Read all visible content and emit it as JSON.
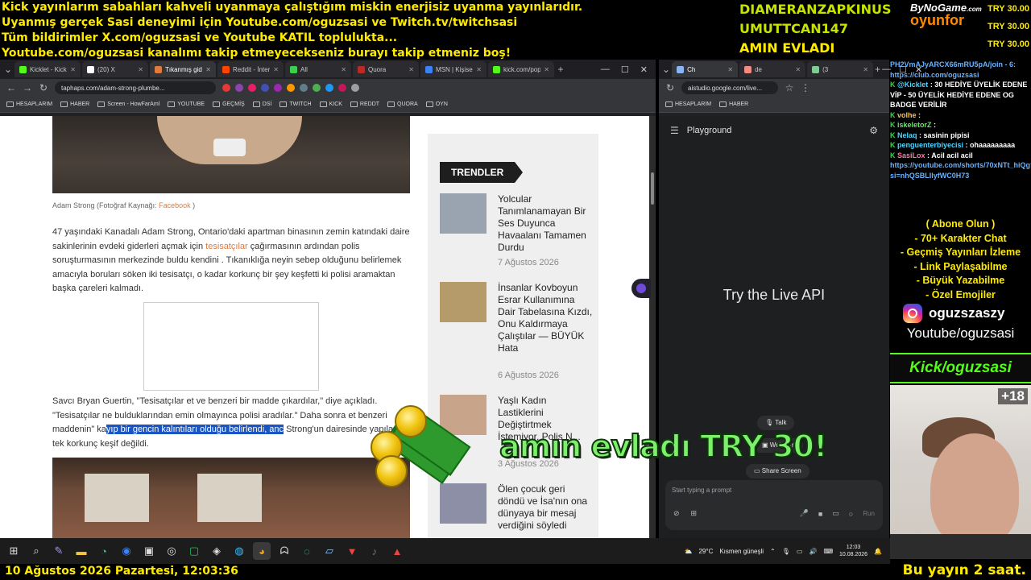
{
  "ticker": [
    "Kick yayınlarım sabahları kahveli uyanmaya çalıştığım miskin enerjisiz uyanma yayınlarıdır.",
    "Uyanmış gerçek Sasi deneyimi için Youtube.com/oguzsasi ve Twitch.tv/twitchsasi",
    "Tüm bildirimler X.com/oguzsasi ve Youtube KATIL toplulukta...",
    "Youtube.com/oguzsasi kanalımı takip etmeyecekseniz burayı takip etmeniz boş!"
  ],
  "donors": [
    "DIAMERANZAPKINUS",
    "UMUTTCAN147",
    "AMIN EVLADI"
  ],
  "brand": {
    "line1": "ByNoGame",
    "line2": "oyunfor",
    "dotcom": ".com"
  },
  "try_amounts": [
    "TRY 30.00",
    "TRY 30.00",
    "TRY 30.00"
  ],
  "browser_left": {
    "tabs": [
      {
        "label": "Kicklet - Kick",
        "color": "#53fc18"
      },
      {
        "label": "(20) X",
        "color": "#ffffff"
      },
      {
        "label": "Tıkanmış gide",
        "color": "#e07a3d"
      },
      {
        "label": "Reddit - İnter",
        "color": "#ff4500"
      },
      {
        "label": "All",
        "color": "#3cd04f"
      },
      {
        "label": "Quora",
        "color": "#b92b27"
      },
      {
        "label": "MSN | Kişisel",
        "color": "#3b82f6"
      },
      {
        "label": "kick.com/pop",
        "color": "#53fc18"
      }
    ],
    "url": "taphaps.com/adam-strong-plumbe...",
    "bookmarks": [
      "HESAPLARIM",
      "HABER",
      "Screen - HowFarAml",
      "YOUTUBE",
      "GEÇMİŞ",
      "DSİ",
      "TWITCH",
      "KICK",
      "REDDT",
      "QUORA",
      "OYN"
    ]
  },
  "article": {
    "caption_prefix": "Adam Strong (Fotoğraf Kaynağı: ",
    "caption_source": "Facebook",
    "caption_suffix": " )",
    "para1_a": "47 yaşındaki Kanadalı Adam Strong, Ontario'daki apartman binasının zemin katındaki daire sakinlerinin evdeki giderleri açmak için ",
    "para1_link": "tesisatçılar",
    "para1_b": " çağırmasının ardından polis soruşturmasının merkezinde buldu kendini . Tıkanıklığa neyin sebep olduğunu belirlemek amacıyla boruları söken iki tesisatçı, o kadar korkunç bir şey keşfetti ki polisi aramaktan başka çareleri kalmadı.",
    "para2_a": "Savcı Bryan Guertin, \"Tesisatçılar et ve benzeri bir madde çıkardılar,\" diye açıkladı. \"Tesisatçılar ne bulduklarından emin olmayınca polisi aradılar.\" Daha sonra et benzeri maddenin\" ka",
    "para2_hl": "yıp bir gencin kalıntıları olduğu belirlendi, anc",
    "para2_b": " Strong'un dairesinde yapılacak tek korkunç keşif değildi."
  },
  "trends": {
    "badge": "TRENDLER",
    "items": [
      {
        "title": "Yolcular Tanımlanamayan Bir Ses Duyunca Havaalanı Tamamen Durdu",
        "date": "7 Ağustos 2026",
        "thumb": "#9aa4b1"
      },
      {
        "title": "İnsanlar Kovboyun Esrar Kullanımına Dair Tabelasına Kızdı, Onu Kaldırmaya Çalıştılar — BÜYÜK Hata",
        "date": "6 Ağustos 2026",
        "thumb": "#b59a6a"
      },
      {
        "title": "Yaşlı Kadın Lastiklerini Değiştirtmek İstemiyor, Polis N...",
        "date": "3 Ağustos 2026",
        "thumb": "#c7a48a"
      },
      {
        "title": "Ölen çocuk geri döndü ve İsa'nın ona dünyaya bir mesaj verdiğini söyledi",
        "date": "",
        "thumb": "#8c8fa6"
      }
    ]
  },
  "browser_right": {
    "tabs": [
      {
        "label": "Ch",
        "color": "#8ab4f8"
      },
      {
        "label": "de",
        "color": "#f28b82"
      },
      {
        "label": "(3",
        "color": "#81c995"
      }
    ],
    "url": "aistudio.google.com/live...",
    "bookmarks": [
      "HESAPLARIM",
      "HABER"
    ]
  },
  "studio": {
    "title": "Playground",
    "live": "Try the Live API",
    "talk": "Talk",
    "webcam": "Webcam",
    "share": "Share Screen",
    "placeholder": "Start typing a prompt",
    "run": "Run"
  },
  "chat": {
    "link1": "PH2VmAJyARCX66mRU5pA/join - 6:",
    "link1b": "https://club.com/oguzsasi",
    "messages": [
      {
        "user": "@Kicklet",
        "text": ": 30 HEDİYE ÜYELİK EDENE VİP - 50 ÜYELİK HEDİYE EDENE OG BADGE VERİLİR",
        "color": "n3"
      },
      {
        "user": "volhe",
        "text": ":",
        "color": "n1"
      },
      {
        "user": "iskeletorZ",
        "text": ":",
        "color": "n2"
      },
      {
        "user": "Nelaq",
        "text": ": sasinin pipisi",
        "color": "n3"
      },
      {
        "user": "penguenterbiyecisi",
        "text": ": ohaaaaaaaaa",
        "color": "n3"
      },
      {
        "user": "SasiLox",
        "text": ": Acil acil acil",
        "color": "n4"
      }
    ],
    "link2": "https://youtube.com/shorts/70xNTt_hiQg?si=nhQSBLIlyfWC0H73"
  },
  "promo": [
    "( Abone Olun )",
    "- 70+ Karakter Chat",
    "- Geçmiş Yayınları İzleme",
    "- Link Paylaşabilme",
    "- Büyük Yazabilme",
    "- Özel Emojiler"
  ],
  "insta": "oguzszaszy",
  "youtube_handle": "Youtube/oguzsasi",
  "kick_handle": "Kick/oguzsasi",
  "cam_badge": "+18",
  "overlay": "amın evladı TRY 30!",
  "taskbar": {
    "weather": "29°C",
    "weather_text": "Kısmen güneşli",
    "time": "12:03",
    "date": "10.08.2026"
  },
  "bottom_date": "10 Ağustos 2026 Pazartesi, 12:03:36",
  "bottom_right": "Bu yayın 2 saat."
}
